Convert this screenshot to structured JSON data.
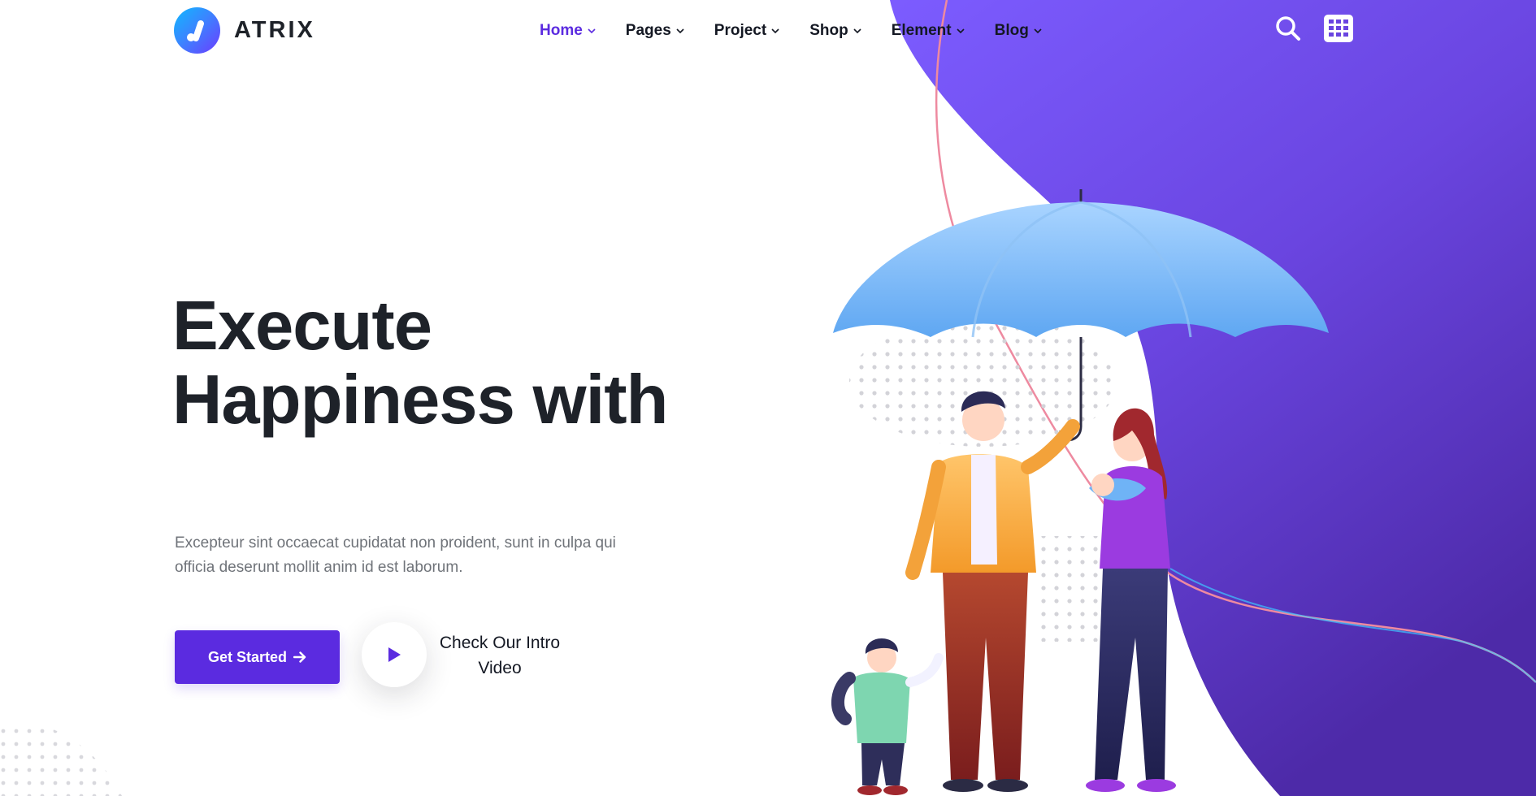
{
  "brand": {
    "name": "ATRIX",
    "primary_color": "#5b2be0",
    "blob_gradient": [
      "#7c5cff",
      "#4d2aa8"
    ]
  },
  "nav": {
    "items": [
      {
        "label": "Home",
        "active": true
      },
      {
        "label": "Pages",
        "active": false
      },
      {
        "label": "Project",
        "active": false
      },
      {
        "label": "Shop",
        "active": false
      },
      {
        "label": "Element",
        "active": false
      },
      {
        "label": "Blog",
        "active": false
      }
    ],
    "icons": [
      "search-icon",
      "grid-menu-icon"
    ]
  },
  "hero": {
    "title_line1": "Execute",
    "title_line2": "Happiness with",
    "description_line1": "Excepteur sint occaecat cupidatat non proident, sunt in culpa qui",
    "description_line2": "officia deserunt mollit anim id est laborum.",
    "cta_label": "Get Started",
    "video_line1": "Check Our Intro",
    "video_line2": "Video"
  }
}
